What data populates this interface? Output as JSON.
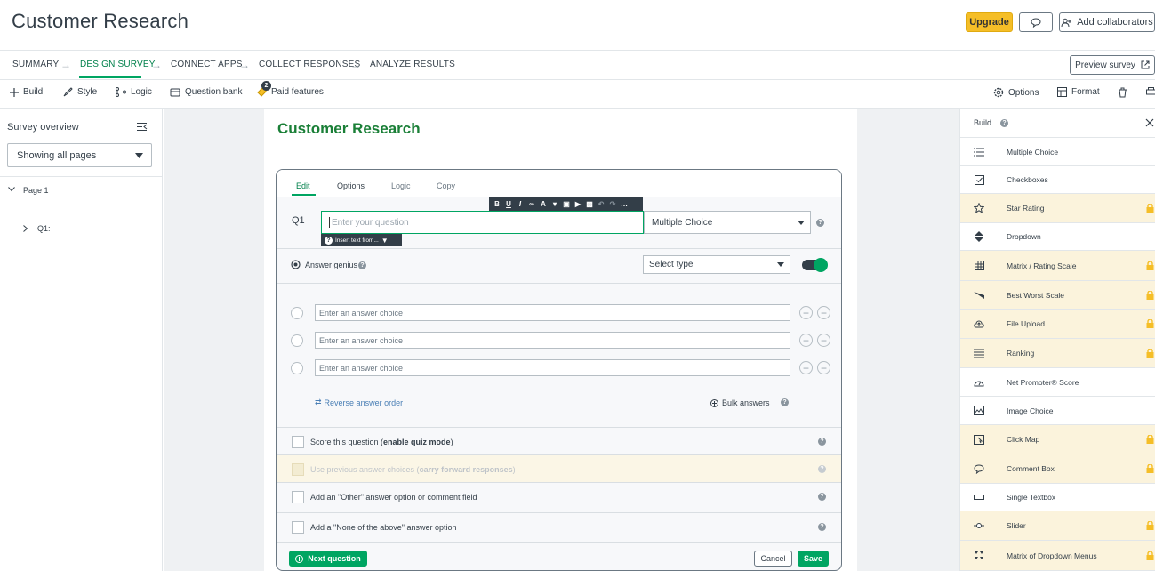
{
  "header": {
    "title": "Customer Research",
    "upgrade_label": "Upgrade",
    "collaborators_label": "Add collaborators"
  },
  "steps": [
    {
      "label": "SUMMARY"
    },
    {
      "label": "DESIGN SURVEY"
    },
    {
      "label": "CONNECT APPS"
    },
    {
      "label": "COLLECT RESPONSES"
    },
    {
      "label": "ANALYZE RESULTS"
    }
  ],
  "preview_label": "Preview survey",
  "toolbar": {
    "build": "Build",
    "style": "Style",
    "logic": "Logic",
    "question_bank": "Question bank",
    "paid_features": "Paid features",
    "paid_badge": "2",
    "options": "Options",
    "format": "Format"
  },
  "sidebar": {
    "title": "Survey overview",
    "page_filter": "Showing all pages",
    "page_label": "Page 1",
    "question_label": "Q1:"
  },
  "survey": {
    "title": "Customer Research"
  },
  "editor": {
    "tabs": [
      {
        "label": "Edit"
      },
      {
        "label": "Options"
      },
      {
        "label": "Logic"
      },
      {
        "label": "Copy"
      }
    ],
    "question_number": "Q1",
    "question_placeholder": "Enter your question",
    "insert_text": "Insert text from...",
    "question_type": "Multiple Choice",
    "answer_genius": "Answer genius",
    "select_type": "Select type",
    "answer_placeholder": "Enter an answer choice",
    "answers": [
      "",
      "",
      ""
    ],
    "reverse_order": "Reverse answer order",
    "bulk_answers": "Bulk answers",
    "score_prefix": "Score this question (",
    "score_bold": "enable quiz mode",
    "score_suffix": ")",
    "previous_prefix": "Use previous answer choices (",
    "previous_bold": "carry forward responses",
    "previous_suffix": ")",
    "other_option": "Add an \"Other\" answer option or comment field",
    "none_option": "Add a \"None of the above\" answer option",
    "next_question": "Next question",
    "cancel": "Cancel",
    "save": "Save"
  },
  "build_panel": {
    "title": "Build",
    "items": [
      {
        "label": "Multiple Choice",
        "icon": "list-icon",
        "locked": false
      },
      {
        "label": "Checkboxes",
        "icon": "checkbox-icon",
        "locked": false
      },
      {
        "label": "Star Rating",
        "icon": "star-icon",
        "locked": true
      },
      {
        "label": "Dropdown",
        "icon": "dropdown-icon",
        "locked": false
      },
      {
        "label": "Matrix / Rating Scale",
        "icon": "matrix-icon",
        "locked": true
      },
      {
        "label": "Best Worst Scale",
        "icon": "best-worst-icon",
        "locked": true
      },
      {
        "label": "File Upload",
        "icon": "upload-icon",
        "locked": true
      },
      {
        "label": "Ranking",
        "icon": "ranking-icon",
        "locked": true
      },
      {
        "label": "Net Promoter® Score",
        "icon": "gauge-icon",
        "locked": false
      },
      {
        "label": "Image Choice",
        "icon": "image-icon",
        "locked": false
      },
      {
        "label": "Click Map",
        "icon": "click-map-icon",
        "locked": true
      },
      {
        "label": "Comment Box",
        "icon": "comment-icon",
        "locked": true
      },
      {
        "label": "Single Textbox",
        "icon": "textbox-icon",
        "locked": false
      },
      {
        "label": "Slider",
        "icon": "slider-icon",
        "locked": true
      },
      {
        "label": "Matrix of Dropdown Menus",
        "icon": "matrix-dropdown-icon",
        "locked": true
      }
    ]
  },
  "colors": {
    "accent": "#00a562",
    "accent_text": "#00804b",
    "upgrade": "#f5be27",
    "locked_row": "#fbf3dc"
  }
}
